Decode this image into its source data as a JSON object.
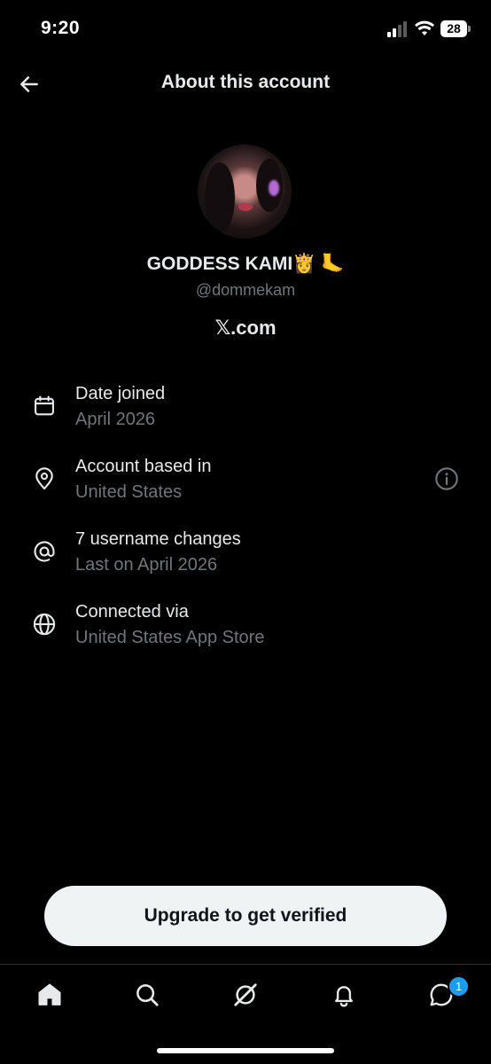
{
  "status_bar": {
    "time": "9:20",
    "battery_level": "28",
    "icons": [
      "signal-icon",
      "wifi-icon",
      "battery-icon"
    ]
  },
  "header": {
    "back_icon": "arrow-left-icon",
    "title": "About this account"
  },
  "profile": {
    "display_name": "GODDESS KAMI👸 🦶",
    "handle": "@dommekam",
    "site": "𝕏.com"
  },
  "info_rows": [
    {
      "icon": "calendar-icon",
      "title": "Date joined",
      "value": "April 2026"
    },
    {
      "icon": "location-pin-icon",
      "title": "Account based in",
      "value": "United States",
      "action_icon": "info-icon"
    },
    {
      "icon": "at-sign-icon",
      "title": "7 username changes",
      "value": "Last on April 2026"
    },
    {
      "icon": "globe-icon",
      "title": "Connected via",
      "value": "United States App Store"
    }
  ],
  "upgrade_button": {
    "label": "Upgrade to get verified"
  },
  "bottom_nav": {
    "items": [
      "home-icon",
      "search-icon",
      "grok-icon",
      "notifications-bell-icon",
      "messages-icon"
    ],
    "messages_badge": "1"
  },
  "colors": {
    "background": "#000000",
    "primary_text": "#e7e9ea",
    "secondary_text": "#71767b",
    "accent": "#1d9bf0",
    "button_bg": "#eff3f4"
  }
}
